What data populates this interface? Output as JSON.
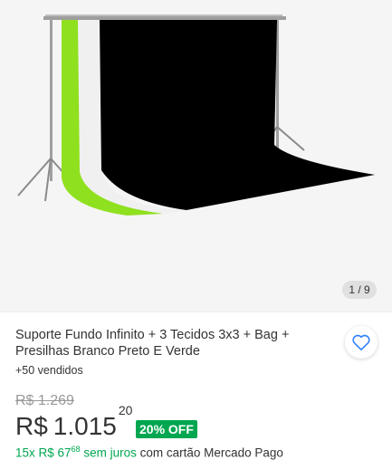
{
  "gallery": {
    "counter": "1 / 9"
  },
  "product": {
    "title": "Suporte Fundo Infinito + 3 Tecidos 3x3 + Bag + Presilhas Branco Preto E Verde",
    "sold": "+50 vendidos",
    "old_price": "R$ 1.269",
    "price_currency": "R$",
    "price_int": "1.015",
    "price_cents": "20",
    "discount": "20% OFF",
    "installment_prefix": "15x R$ 67",
    "installment_cents": "68",
    "installment_mid": " sem juros",
    "installment_suffix": " com cartão Mercado Pago"
  },
  "icons": {
    "favorite": "heart-outline-icon"
  },
  "colors": {
    "accent": "#3483fa",
    "discount": "#00a650",
    "background_black": "#000000",
    "background_green": "#8fe01e"
  }
}
